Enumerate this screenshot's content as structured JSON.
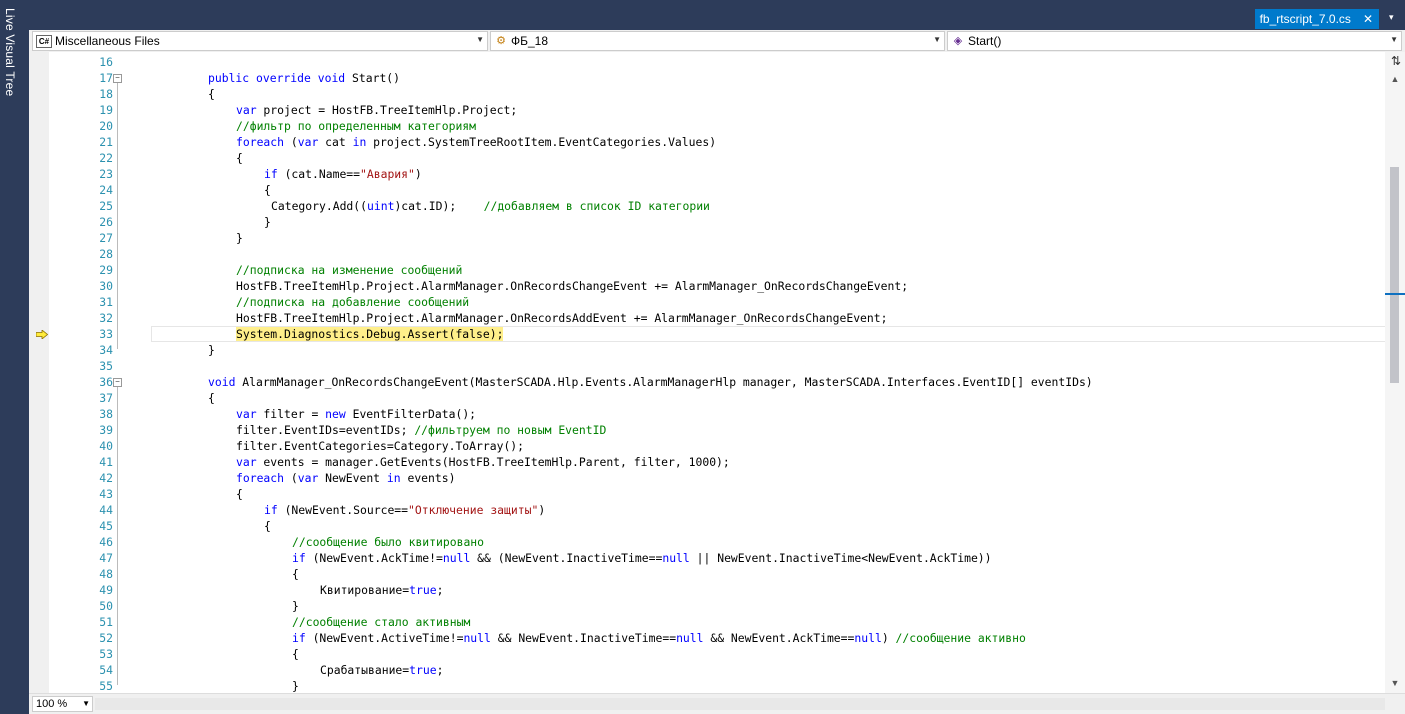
{
  "left_panel": {
    "title": "Live Visual Tree"
  },
  "document_tab": {
    "title": "fb_rtscript_7.0.cs",
    "close": "✕",
    "dropdown": "▾"
  },
  "navigation": {
    "project": {
      "label": "Miscellaneous Files",
      "icon": "csharp-file-icon"
    },
    "type": {
      "label": "ФБ_18",
      "icon": "class-icon"
    },
    "member": {
      "label": "Start()",
      "icon": "method-icon"
    }
  },
  "zoom": {
    "value": "100 %"
  },
  "current_line": 33,
  "lines": [
    {
      "n": "16",
      "indent": 0,
      "tokens": []
    },
    {
      "n": "17",
      "indent": 4,
      "fold": true,
      "tokens": [
        {
          "t": "kw",
          "v": "public override void"
        },
        {
          "t": "p",
          "v": " Start()"
        }
      ]
    },
    {
      "n": "18",
      "indent": 4,
      "tokens": [
        {
          "t": "p",
          "v": "{"
        }
      ]
    },
    {
      "n": "19",
      "indent": 8,
      "tokens": [
        {
          "t": "kw",
          "v": "var"
        },
        {
          "t": "p",
          "v": " project = HostFB.TreeItemHlp.Project;"
        }
      ]
    },
    {
      "n": "20",
      "indent": 8,
      "tokens": [
        {
          "t": "cm",
          "v": "//фильтр по определенным категориям"
        }
      ]
    },
    {
      "n": "21",
      "indent": 8,
      "tokens": [
        {
          "t": "kw",
          "v": "foreach"
        },
        {
          "t": "p",
          "v": " ("
        },
        {
          "t": "kw",
          "v": "var"
        },
        {
          "t": "p",
          "v": " cat "
        },
        {
          "t": "kw",
          "v": "in"
        },
        {
          "t": "p",
          "v": " project.SystemTreeRootItem.EventCategories.Values)"
        }
      ]
    },
    {
      "n": "22",
      "indent": 8,
      "tokens": [
        {
          "t": "p",
          "v": "{"
        }
      ]
    },
    {
      "n": "23",
      "indent": 12,
      "tokens": [
        {
          "t": "kw",
          "v": "if"
        },
        {
          "t": "p",
          "v": " (cat.Name=="
        },
        {
          "t": "st",
          "v": "\"Авария\""
        },
        {
          "t": "p",
          "v": ")"
        }
      ]
    },
    {
      "n": "24",
      "indent": 12,
      "tokens": [
        {
          "t": "p",
          "v": "{"
        }
      ]
    },
    {
      "n": "25",
      "indent": 13,
      "tokens": [
        {
          "t": "p",
          "v": "Category.Add(("
        },
        {
          "t": "kw",
          "v": "uint"
        },
        {
          "t": "p",
          "v": ")cat.ID);    "
        },
        {
          "t": "cm",
          "v": "//добавляем в список ID категории"
        }
      ]
    },
    {
      "n": "26",
      "indent": 12,
      "tokens": [
        {
          "t": "p",
          "v": "}"
        }
      ]
    },
    {
      "n": "27",
      "indent": 8,
      "tokens": [
        {
          "t": "p",
          "v": "}"
        }
      ]
    },
    {
      "n": "28",
      "indent": 0,
      "tokens": []
    },
    {
      "n": "29",
      "indent": 8,
      "tokens": [
        {
          "t": "cm",
          "v": "//подписка на изменение сообщений"
        }
      ]
    },
    {
      "n": "30",
      "indent": 8,
      "tokens": [
        {
          "t": "p",
          "v": "HostFB.TreeItemHlp.Project.AlarmManager.OnRecordsChangeEvent += AlarmManager_OnRecordsChangeEvent;"
        }
      ]
    },
    {
      "n": "31",
      "indent": 8,
      "tokens": [
        {
          "t": "cm",
          "v": "//подписка на добавление сообщений"
        }
      ]
    },
    {
      "n": "32",
      "indent": 8,
      "tokens": [
        {
          "t": "p",
          "v": "HostFB.TreeItemHlp.Project.AlarmManager.OnRecordsAddEvent += AlarmManager_OnRecordsChangeEvent;"
        }
      ]
    },
    {
      "n": "33",
      "indent": 8,
      "tokens": [
        {
          "t": "hl",
          "v": "System.Diagnostics.Debug.Assert(false);"
        }
      ]
    },
    {
      "n": "34",
      "indent": 4,
      "tokens": [
        {
          "t": "p",
          "v": "}"
        }
      ]
    },
    {
      "n": "35",
      "indent": 0,
      "tokens": []
    },
    {
      "n": "36",
      "indent": 4,
      "fold": true,
      "tokens": [
        {
          "t": "kw",
          "v": "void"
        },
        {
          "t": "p",
          "v": " AlarmManager_OnRecordsChangeEvent(MasterSCADA.Hlp.Events.AlarmManagerHlp manager, MasterSCADA.Interfaces.EventID[] eventIDs)"
        }
      ]
    },
    {
      "n": "37",
      "indent": 4,
      "tokens": [
        {
          "t": "p",
          "v": "{"
        }
      ]
    },
    {
      "n": "38",
      "indent": 8,
      "tokens": [
        {
          "t": "kw",
          "v": "var"
        },
        {
          "t": "p",
          "v": " filter = "
        },
        {
          "t": "kw",
          "v": "new"
        },
        {
          "t": "p",
          "v": " EventFilterData();"
        }
      ]
    },
    {
      "n": "39",
      "indent": 8,
      "tokens": [
        {
          "t": "p",
          "v": "filter.EventIDs=eventIDs; "
        },
        {
          "t": "cm",
          "v": "//фильтруем по новым EventID"
        }
      ]
    },
    {
      "n": "40",
      "indent": 8,
      "tokens": [
        {
          "t": "p",
          "v": "filter.EventCategories=Category.ToArray();"
        }
      ]
    },
    {
      "n": "41",
      "indent": 8,
      "tokens": [
        {
          "t": "kw",
          "v": "var"
        },
        {
          "t": "p",
          "v": " events = manager.GetEvents(HostFB.TreeItemHlp.Parent, filter, 1000);"
        }
      ]
    },
    {
      "n": "42",
      "indent": 8,
      "tokens": [
        {
          "t": "kw",
          "v": "foreach"
        },
        {
          "t": "p",
          "v": " ("
        },
        {
          "t": "kw",
          "v": "var"
        },
        {
          "t": "p",
          "v": " NewEvent "
        },
        {
          "t": "kw",
          "v": "in"
        },
        {
          "t": "p",
          "v": " events)"
        }
      ]
    },
    {
      "n": "43",
      "indent": 8,
      "tokens": [
        {
          "t": "p",
          "v": "{"
        }
      ]
    },
    {
      "n": "44",
      "indent": 12,
      "tokens": [
        {
          "t": "kw",
          "v": "if"
        },
        {
          "t": "p",
          "v": " (NewEvent.Source=="
        },
        {
          "t": "st",
          "v": "\"Отключение защиты\""
        },
        {
          "t": "p",
          "v": ")"
        }
      ]
    },
    {
      "n": "45",
      "indent": 12,
      "tokens": [
        {
          "t": "p",
          "v": "{"
        }
      ]
    },
    {
      "n": "46",
      "indent": 16,
      "tokens": [
        {
          "t": "cm",
          "v": "//сообщение было квитировано"
        }
      ]
    },
    {
      "n": "47",
      "indent": 16,
      "tokens": [
        {
          "t": "kw",
          "v": "if"
        },
        {
          "t": "p",
          "v": " (NewEvent.AckTime!="
        },
        {
          "t": "kw",
          "v": "null"
        },
        {
          "t": "p",
          "v": " && (NewEvent.InactiveTime=="
        },
        {
          "t": "kw",
          "v": "null"
        },
        {
          "t": "p",
          "v": " || NewEvent.InactiveTime<NewEvent.AckTime))"
        }
      ]
    },
    {
      "n": "48",
      "indent": 16,
      "tokens": [
        {
          "t": "p",
          "v": "{"
        }
      ]
    },
    {
      "n": "49",
      "indent": 20,
      "tokens": [
        {
          "t": "p",
          "v": "Квитирование="
        },
        {
          "t": "kw",
          "v": "true"
        },
        {
          "t": "p",
          "v": ";"
        }
      ]
    },
    {
      "n": "50",
      "indent": 16,
      "tokens": [
        {
          "t": "p",
          "v": "}"
        }
      ]
    },
    {
      "n": "51",
      "indent": 16,
      "tokens": [
        {
          "t": "cm",
          "v": "//сообщение стало активным"
        }
      ]
    },
    {
      "n": "52",
      "indent": 16,
      "tokens": [
        {
          "t": "kw",
          "v": "if"
        },
        {
          "t": "p",
          "v": " (NewEvent.ActiveTime!="
        },
        {
          "t": "kw",
          "v": "null"
        },
        {
          "t": "p",
          "v": " && NewEvent.InactiveTime=="
        },
        {
          "t": "kw",
          "v": "null"
        },
        {
          "t": "p",
          "v": " && NewEvent.AckTime=="
        },
        {
          "t": "kw",
          "v": "null"
        },
        {
          "t": "p",
          "v": ") "
        },
        {
          "t": "cm",
          "v": "//сообщение активно"
        }
      ]
    },
    {
      "n": "53",
      "indent": 16,
      "tokens": [
        {
          "t": "p",
          "v": "{"
        }
      ]
    },
    {
      "n": "54",
      "indent": 20,
      "tokens": [
        {
          "t": "p",
          "v": "Срабатывание="
        },
        {
          "t": "kw",
          "v": "true"
        },
        {
          "t": "p",
          "v": ";"
        }
      ]
    },
    {
      "n": "55",
      "indent": 16,
      "tokens": [
        {
          "t": "p",
          "v": "}"
        }
      ]
    }
  ]
}
